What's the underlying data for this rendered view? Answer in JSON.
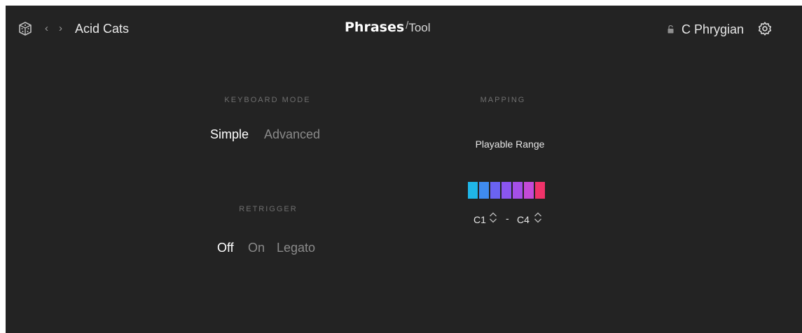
{
  "header": {
    "preset_name": "Acid Cats",
    "brand_main": "Phrases",
    "brand_slash": "/",
    "brand_sub": "Tool",
    "scale": "C Phrygian",
    "icons": [
      "dice-icon",
      "chevron-left-icon",
      "chevron-right-icon",
      "lock-icon",
      "gear-icon"
    ]
  },
  "keyboard_mode": {
    "title": "KEYBOARD MODE",
    "options": [
      "Simple",
      "Advanced"
    ],
    "selected": "Simple"
  },
  "retrigger": {
    "title": "RETRIGGER",
    "options": [
      "Off",
      "On",
      "Legato"
    ],
    "selected": "Off"
  },
  "mapping": {
    "title": "MAPPING",
    "label": "Playable Range",
    "range_low": "C1",
    "range_sep": "-",
    "range_high": "C4",
    "key_colors": [
      "#1fb6e8",
      "#3f8bf0",
      "#6a63f2",
      "#8a55f0",
      "#a54fe8",
      "#c44ad8",
      "#f0336a"
    ]
  },
  "colors": {
    "background": "#232323",
    "text_active": "#ffffff",
    "text_inactive": "#8a8a8a",
    "section_title": "#6f6f6f"
  }
}
